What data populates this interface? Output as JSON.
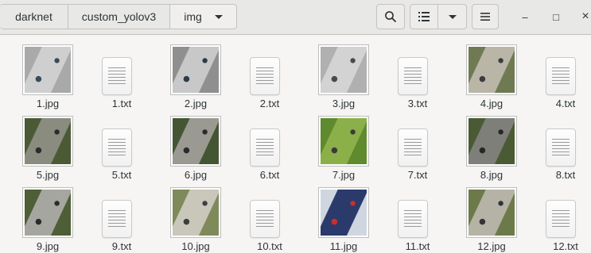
{
  "breadcrumbs": [
    {
      "label": "darknet"
    },
    {
      "label": "custom_yolov3"
    },
    {
      "label": "img"
    }
  ],
  "icons": {
    "search": "search-icon",
    "view": "list-view-icon",
    "view_options": "chevron-down-icon",
    "menu": "hamburger-menu-icon",
    "minimize": "minimize-icon",
    "maximize": "maximize-icon",
    "close": "close-icon"
  },
  "window_buttons": {
    "minimize": "–",
    "maximize": "□",
    "close": "×"
  },
  "files": [
    {
      "name": "1.jpg",
      "type": "image",
      "colors": [
        "#cfcfcf",
        "#a9a9a9",
        "#3a4a5a"
      ]
    },
    {
      "name": "1.txt",
      "type": "text"
    },
    {
      "name": "2.jpg",
      "type": "image",
      "colors": [
        "#c8c8c8",
        "#8f8f8f",
        "#2c3a4a"
      ]
    },
    {
      "name": "2.txt",
      "type": "text"
    },
    {
      "name": "3.jpg",
      "type": "image",
      "colors": [
        "#d3d3d3",
        "#b0b0b0",
        "#4a4a4a"
      ]
    },
    {
      "name": "3.txt",
      "type": "text"
    },
    {
      "name": "4.jpg",
      "type": "image",
      "colors": [
        "#b9b6a8",
        "#6f7a52",
        "#3c3c3c"
      ]
    },
    {
      "name": "4.txt",
      "type": "text"
    },
    {
      "name": "5.jpg",
      "type": "image",
      "colors": [
        "#8a8c80",
        "#4b5a35",
        "#2b2b2b"
      ]
    },
    {
      "name": "5.txt",
      "type": "text"
    },
    {
      "name": "6.jpg",
      "type": "image",
      "colors": [
        "#9a9a92",
        "#445533",
        "#2a2a2a"
      ]
    },
    {
      "name": "6.txt",
      "type": "text"
    },
    {
      "name": "7.jpg",
      "type": "image",
      "colors": [
        "#8bb04a",
        "#5f8a2e",
        "#3a3a3a"
      ]
    },
    {
      "name": "7.txt",
      "type": "text"
    },
    {
      "name": "8.jpg",
      "type": "image",
      "colors": [
        "#7f7f7a",
        "#4a5a34",
        "#262626"
      ]
    },
    {
      "name": "8.txt",
      "type": "text"
    },
    {
      "name": "9.jpg",
      "type": "image",
      "colors": [
        "#a6a6a0",
        "#4e5e36",
        "#2a2a2a"
      ]
    },
    {
      "name": "9.txt",
      "type": "text"
    },
    {
      "name": "10.jpg",
      "type": "image",
      "colors": [
        "#c9c6ba",
        "#7e8a5a",
        "#3e3e3e"
      ]
    },
    {
      "name": "10.txt",
      "type": "text"
    },
    {
      "name": "11.jpg",
      "type": "image",
      "colors": [
        "#2a3a6a",
        "#cfd6e0",
        "#c83030"
      ]
    },
    {
      "name": "11.txt",
      "type": "text"
    },
    {
      "name": "12.jpg",
      "type": "image",
      "colors": [
        "#b5b3a6",
        "#6c7a4a",
        "#343434"
      ]
    },
    {
      "name": "12.txt",
      "type": "text"
    }
  ]
}
